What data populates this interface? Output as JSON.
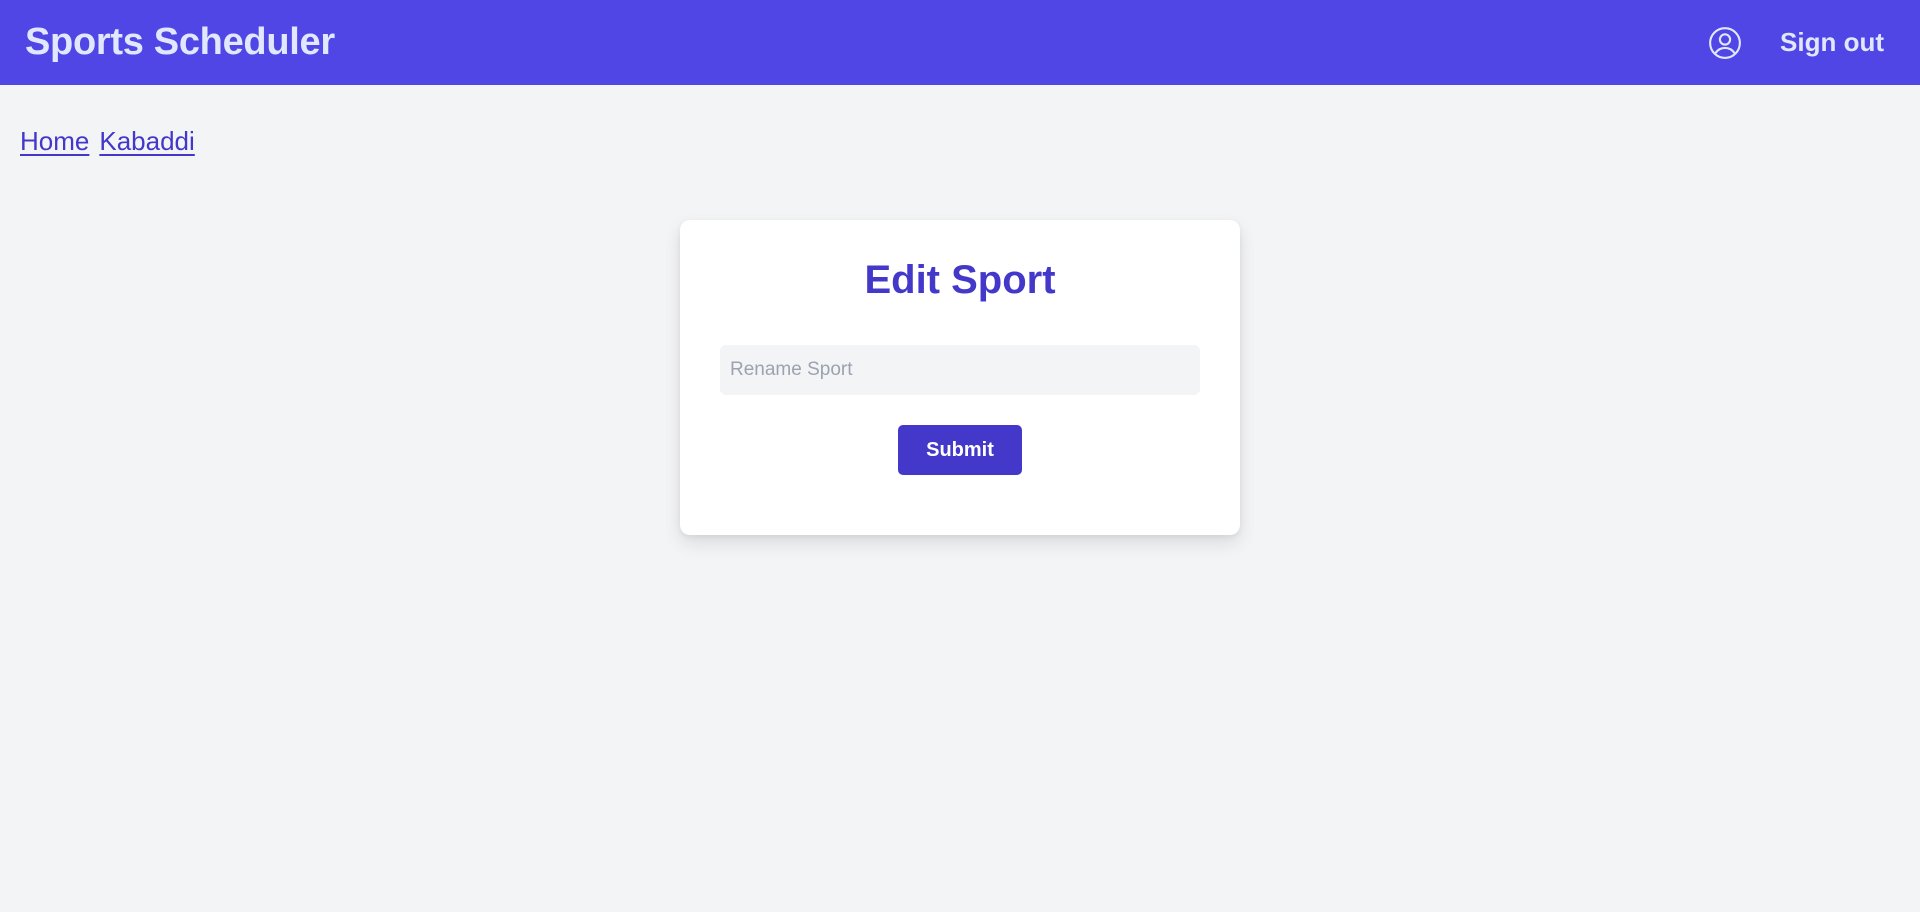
{
  "app": {
    "title": "Sports Scheduler"
  },
  "nav": {
    "user_icon": "user-circle-icon",
    "sign_out_label": "Sign out"
  },
  "breadcrumb": {
    "items": [
      {
        "label": "Home"
      },
      {
        "label": "Kabaddi"
      }
    ]
  },
  "form": {
    "title": "Edit Sport",
    "rename_value": "",
    "rename_placeholder": "Rename Sport",
    "submit_label": "Submit"
  },
  "colors": {
    "navbar": "#4f46e5",
    "accent": "#4338ca",
    "page_background": "#f3f4f6",
    "nav_text": "#e0e7ff"
  }
}
